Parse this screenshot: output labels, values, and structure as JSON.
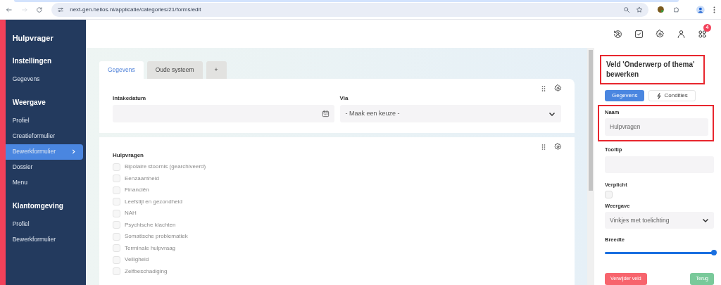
{
  "browser": {
    "url": "next-gen.hellos.nl/applicatie/categories/21/forms/edit"
  },
  "header": {
    "notification_count": "4"
  },
  "sidebar": {
    "title": "Hulpvrager",
    "sections": [
      {
        "heading": "Instellingen",
        "items": [
          {
            "label": "Gegevens",
            "selected": false
          }
        ]
      },
      {
        "heading": "Weergave",
        "items": [
          {
            "label": "Profiel",
            "selected": false
          },
          {
            "label": "Creatieformulier",
            "selected": false
          },
          {
            "label": "Bewerkformulier",
            "selected": true
          },
          {
            "label": "Dossier",
            "selected": false
          },
          {
            "label": "Menu",
            "selected": false
          }
        ]
      },
      {
        "heading": "Klantomgeving",
        "items": [
          {
            "label": "Profiel",
            "selected": false
          },
          {
            "label": "Bewerkformulier",
            "selected": false
          }
        ]
      }
    ]
  },
  "tabs": [
    {
      "label": "Gegevens",
      "selected": true
    },
    {
      "label": "Oude systeem",
      "selected": false
    },
    {
      "label": "+",
      "selected": false
    }
  ],
  "form": {
    "date_label": "Intakedatum",
    "via_label": "Via",
    "via_placeholder": "- Maak een keuze -",
    "group_label": "Hulpvragen",
    "options": [
      {
        "label": "Bipolaire stoornis (gearchiveerd)",
        "checked": false
      },
      {
        "label": "Eenzaamheid",
        "checked": false
      },
      {
        "label": "Financiën",
        "checked": false
      },
      {
        "label": "Leefstijl en gezondheid",
        "checked": false
      },
      {
        "label": "NAH",
        "checked": false
      },
      {
        "label": "Psychische klachten",
        "checked": false
      },
      {
        "label": "Somatische problematiek",
        "checked": false
      },
      {
        "label": "Terminale hulpvraag",
        "checked": false
      },
      {
        "label": "Veiligheid",
        "checked": false
      },
      {
        "label": "Zelfbeschadiging",
        "checked": false
      }
    ]
  },
  "panel": {
    "title": "Veld 'Onderwerp of thema' bewerken",
    "title_highlighted": true,
    "tabs": [
      {
        "label": "Gegevens",
        "selected": true
      },
      {
        "label": "Condities",
        "selected": false
      }
    ],
    "name_label": "Naam",
    "name_value": "Hulpvragen",
    "name_highlighted": true,
    "tooltip_label": "Tooltip",
    "required_label": "Verplicht",
    "required_checked": false,
    "display_label": "Weergave",
    "display_value": "Vinkjes met toelichting",
    "width_label": "Breedte",
    "width": {
      "level": 1
    },
    "delete_button": "Verwijder veld",
    "back_button": "Terug"
  }
}
